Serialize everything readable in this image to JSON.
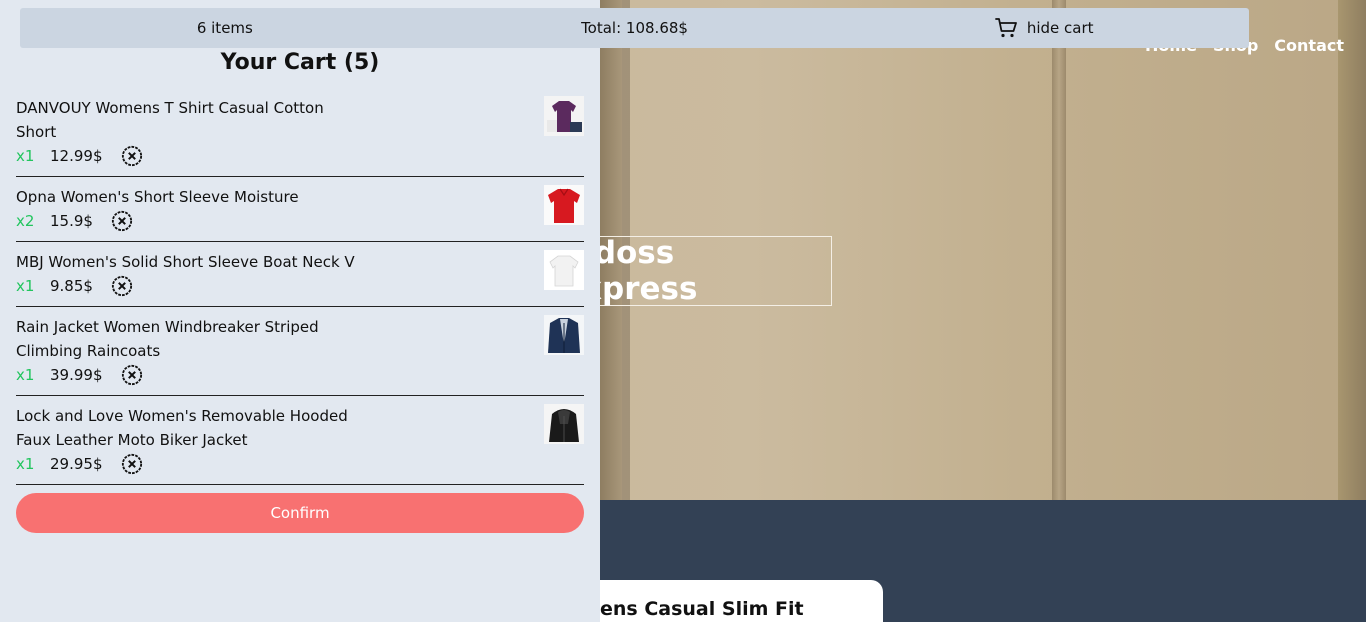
{
  "topbar": {
    "items_count": "6 items",
    "total": "Total: 108.68$",
    "hide_cart_label": "hide cart",
    "cart_icon": "shopping-cart-icon"
  },
  "nav": {
    "home": "Home",
    "shop": "Shop",
    "contact": "Contact"
  },
  "hero": {
    "title": "didoss express"
  },
  "product_card": {
    "title": "ens Casual Slim Fit"
  },
  "cart": {
    "title": "Your Cart (5)",
    "confirm_label": "Confirm",
    "remove_icon": "circle-x-icon",
    "items": [
      {
        "name": "DANVOUY Womens T Shirt Casual Cotton Short",
        "qty": "x1",
        "price": "12.99$",
        "image": "purple-tshirt"
      },
      {
        "name": "Opna Women's Short Sleeve Moisture",
        "qty": "x2",
        "price": "15.9$",
        "image": "red-tshirt"
      },
      {
        "name": "MBJ Women's Solid Short Sleeve Boat Neck V",
        "qty": "x1",
        "price": "9.85$",
        "image": "white-tshirt"
      },
      {
        "name": "Rain Jacket Women Windbreaker Striped Climbing Raincoats",
        "qty": "x1",
        "price": "39.99$",
        "image": "navy-jacket"
      },
      {
        "name": "Lock and Love Women's Removable Hooded Faux Leather Moto Biker Jacket",
        "qty": "x1",
        "price": "29.95$",
        "image": "black-leather-jacket"
      }
    ]
  },
  "colors": {
    "qty_green": "#22c55e",
    "confirm_bg": "#f87171",
    "panel_bg": "#e2e8f0",
    "topbar_bg": "#cbd5e1",
    "dark_section": "#334155"
  }
}
